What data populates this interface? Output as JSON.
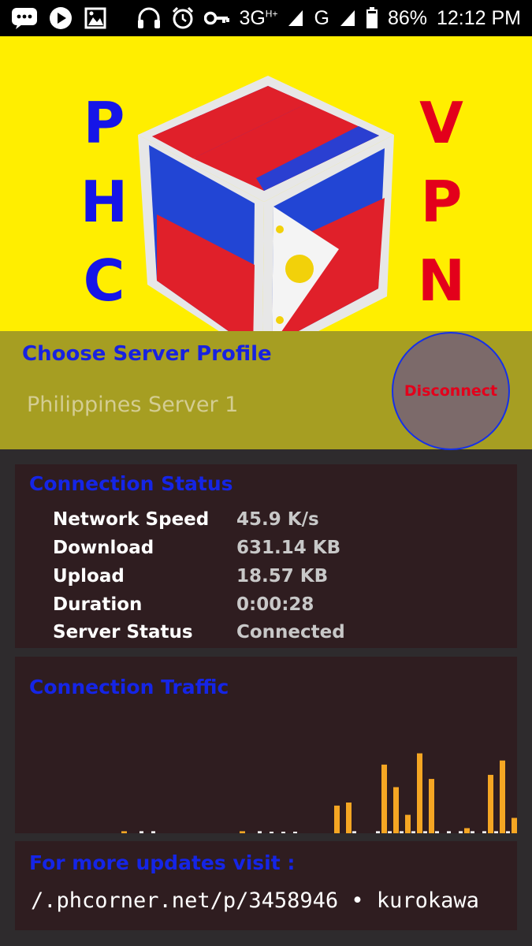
{
  "status_bar": {
    "network": "3G",
    "network_plus": "H+",
    "network2": "G",
    "battery": "86%",
    "time": "12:12 PM"
  },
  "banner": {
    "left_letters": [
      "P",
      "H",
      "C"
    ],
    "right_letters": [
      "V",
      "P",
      "N"
    ],
    "brand_colors": {
      "blue": "#1515e8",
      "red": "#e3001b",
      "yellow": "#ffee00"
    }
  },
  "profile": {
    "title": "Choose Server Profile",
    "selected_server": "Philippines Server 1",
    "disconnect_label": "Disconnect"
  },
  "connection_status": {
    "title": "Connection Status",
    "rows": [
      {
        "label": "Network Speed",
        "value": "45.9 K/s"
      },
      {
        "label": "Download",
        "value": "631.14 KB"
      },
      {
        "label": "Upload",
        "value": "18.57 KB"
      },
      {
        "label": "Duration",
        "value": "0:00:28"
      },
      {
        "label": "Server Status",
        "value": "Connected"
      }
    ]
  },
  "traffic": {
    "title": "Connection Traffic"
  },
  "chart_data": {
    "type": "bar",
    "series": [
      {
        "color": "#f5a623",
        "values": [
          0,
          0,
          0,
          0,
          0,
          2,
          0,
          0,
          0,
          0,
          0,
          0,
          0,
          0,
          0,
          2,
          0,
          0,
          0,
          0,
          0,
          0,
          0,
          27,
          30,
          0,
          0,
          67,
          45,
          18,
          78,
          53,
          0,
          0,
          5,
          0,
          57,
          71,
          15,
          73,
          40,
          73,
          4,
          46,
          27
        ]
      },
      {
        "color": "#ffffff",
        "values": [
          0,
          0,
          0,
          0,
          0,
          0,
          2,
          2,
          0,
          0,
          0,
          0,
          0,
          0,
          0,
          0,
          2,
          1,
          1,
          1,
          0,
          0,
          0,
          0,
          2,
          0,
          2,
          2,
          2,
          2,
          2,
          2,
          2,
          2,
          2,
          2,
          2,
          2,
          2,
          2,
          2,
          2,
          2,
          2,
          2
        ]
      }
    ]
  },
  "updates": {
    "title": "For more updates visit :",
    "link": "/.phcorner.net/p/3458946 • kurokawa"
  }
}
